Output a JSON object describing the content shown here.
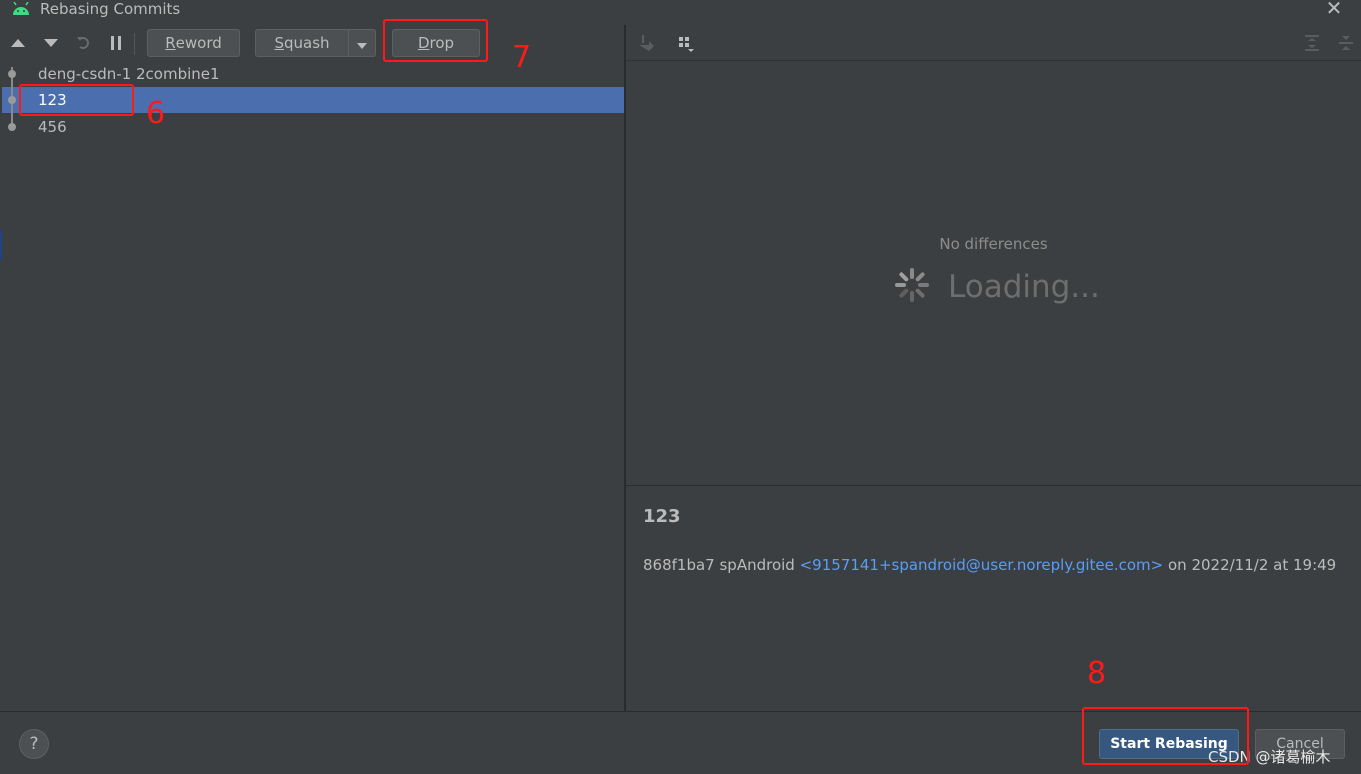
{
  "window": {
    "title": "Rebasing Commits",
    "close_glyph": "✕"
  },
  "toolbar": {
    "reword_label": "Reword",
    "reword_mnemonic": "R",
    "reword_rest": "eword",
    "squash_label": "Squash",
    "squash_mnemonic": "S",
    "squash_rest": "quash",
    "drop_label": "Drop",
    "drop_mnemonic": "D",
    "drop_rest": "rop"
  },
  "commits": [
    {
      "label": "deng-csdn-1 2combine1",
      "selected": false
    },
    {
      "label": "123",
      "selected": true
    },
    {
      "label": "456",
      "selected": false
    }
  ],
  "diff": {
    "empty_text": "No differences",
    "loading_text": "Loading..."
  },
  "details": {
    "subject": "123",
    "hash_author": "868f1ba7 spAndroid ",
    "email": "<9157141+spandroid@user.noreply.gitee.com>",
    "date": " on 2022/11/2 at 19:49"
  },
  "footer": {
    "help_label": "?",
    "start_label": "Start Rebasing",
    "cancel_label": "Cancel",
    "watermark": "CSDN @诸葛榆木"
  },
  "annotations": {
    "commit_step": "6",
    "drop_step": "7",
    "start_step": "8"
  },
  "colors": {
    "background": "#3c3f41",
    "selection": "#4b6eaf",
    "link": "#589df6",
    "primary": "#365880",
    "annotation": "#ff1a1a",
    "android": "#3ddc84"
  }
}
